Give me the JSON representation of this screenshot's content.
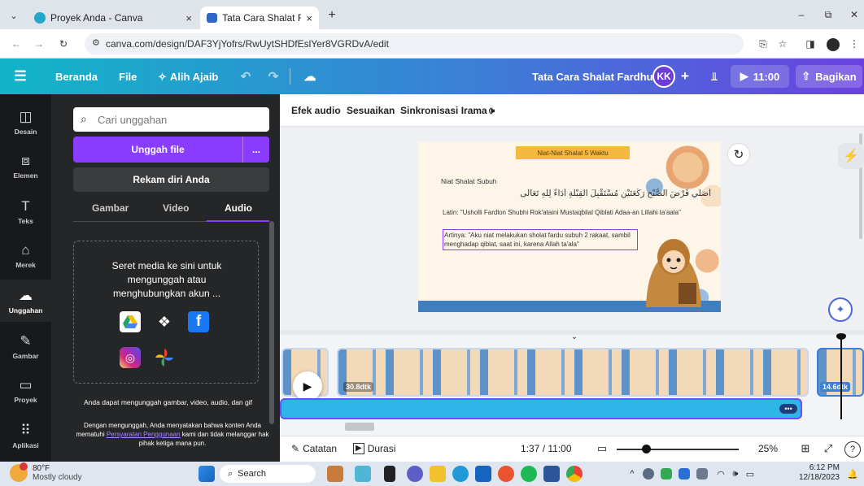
{
  "browser": {
    "tabs": [
      {
        "title": "Proyek Anda - Canva"
      },
      {
        "title": "Tata Cara Shalat Fardhu - Video"
      }
    ],
    "url": "canva.com/design/DAF3YjYofrs/RwUytSHDfEslYer8VGRDvA/edit"
  },
  "header": {
    "home": "Beranda",
    "file": "File",
    "magic": "Alih Ajaib",
    "title": "Tata Cara Shalat Fardhu",
    "avatar": "KK",
    "play_time": "11:00",
    "share": "Bagikan"
  },
  "rail": {
    "items": [
      {
        "label": "Desain"
      },
      {
        "label": "Elemen"
      },
      {
        "label": "Teks"
      },
      {
        "label": "Merek"
      },
      {
        "label": "Unggahan"
      },
      {
        "label": "Gambar"
      },
      {
        "label": "Proyek"
      },
      {
        "label": "Aplikasi"
      }
    ]
  },
  "panel": {
    "search_placeholder": "Cari unggahan",
    "upload_button": "Unggah file",
    "more": "...",
    "record_button": "Rekam diri Anda",
    "tabs": [
      "Gambar",
      "Video",
      "Audio"
    ],
    "active_tab": "Audio",
    "drop_text": "Seret media ke sini untuk mengunggah atau menghubungkan akun ...",
    "info": "Anda dapat mengunggah gambar, video, audio, dan gif",
    "terms_prefix": "Dengan mengunggah, Anda menyatakan bahwa konten Anda mematuhi",
    "terms_link": "Persyaratan Penggunaan",
    "terms_suffix": "kami dan tidak melanggar hak pihak ketiga mana pun."
  },
  "editor_toolbar": {
    "effects": "Efek audio",
    "adjust": "Sesuaikan",
    "sync": "Sinkronisasi Irama"
  },
  "slide": {
    "banner": "Niat-Niat Shalat 5 Waktu",
    "heading": "Niat Shalat Subuh",
    "arabic": "أُصَلِّي فَرْضَ الصُّبْحِ رَكْعَتَيْنِ مُسْتَقْبِلَ الْقِبْلَةِ أَدَاءً لِلّٰهِ تَعَالَى",
    "latin": "Latin: \"Usholli Fardlon Shubhi Rok'ataini Mustaqbilal Qiblati Adaa-an Lillahi ta'aala\"",
    "meaning": "Artinya: \"Aku niat melakukan sholat fardu subuh 2 rakaat, sambil menghadap qiblat, saat ini, karena Allah ta'ala\""
  },
  "timeline": {
    "clip1_duration": "30.8dtk",
    "clip2_duration": "14.6dtk"
  },
  "bottom": {
    "notes": "Catatan",
    "duration": "Durasi",
    "time": "1:37 / 11:00",
    "zoom": "25%"
  },
  "taskbar": {
    "temp": "80°F",
    "weather": "Mostly cloudy",
    "search": "Search",
    "time": "6:12 PM",
    "date": "12/18/2023"
  },
  "colors": {
    "accent": "#8b3dff",
    "header_start": "#12b5c8",
    "header_end": "#6a41e0",
    "panel": "#252627",
    "rail": "#18191b"
  }
}
